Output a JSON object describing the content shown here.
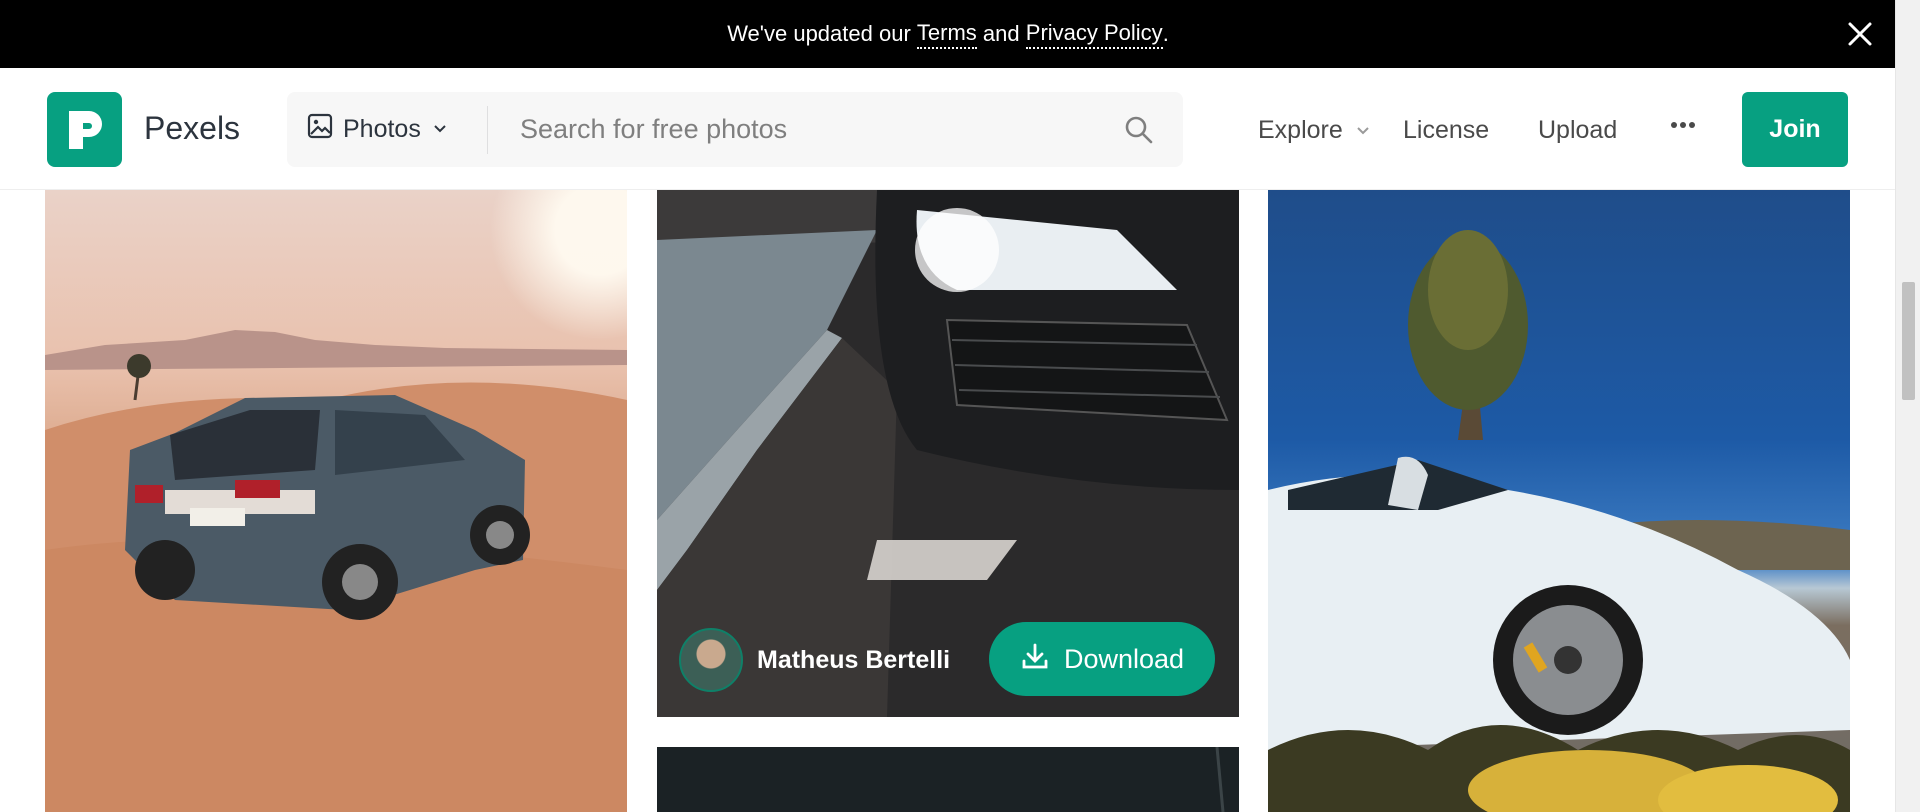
{
  "banner": {
    "prefix": "We've updated our",
    "terms": "Terms",
    "and": "and",
    "privacy": "Privacy Policy",
    "suffix": "."
  },
  "header": {
    "brand": "Pexels",
    "search_type": "Photos",
    "search_placeholder": "Search for free photos",
    "nav": {
      "explore": "Explore",
      "license": "License",
      "upload": "Upload"
    },
    "join_label": "Join"
  },
  "photos": {
    "featured_author": "Matheus Bertelli",
    "download_label": "Download"
  },
  "colors": {
    "brand_green": "#07a081",
    "banner_bg": "#000000"
  },
  "icons": [
    "close-icon",
    "pexels-logo-icon",
    "image-icon",
    "chevron-down-icon",
    "search-icon",
    "more-icon",
    "download-icon"
  ]
}
